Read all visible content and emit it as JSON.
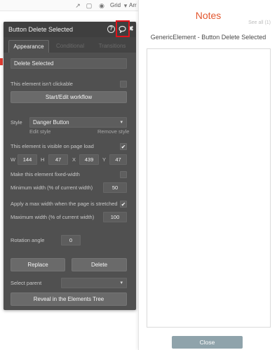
{
  "toolbar": {
    "grid_label": "Grid",
    "arrange_label": "Arr"
  },
  "panel": {
    "title": "Button Delete Selected",
    "tabs": [
      {
        "label": "Appearance",
        "active": true
      },
      {
        "label": "Conditional",
        "active": false
      },
      {
        "label": "Transitions",
        "active": false
      }
    ],
    "text_value": "Delete Selected",
    "not_clickable_label": "This element isn't clickable",
    "not_clickable_checked": false,
    "workflow_button": "Start/Edit workflow",
    "style_label": "Style",
    "style_value": "Danger Button",
    "edit_style": "Edit style",
    "remove_style": "Remove style",
    "visible_label": "This element is visible on page load",
    "visible_checked": true,
    "dims": {
      "w_label": "W",
      "w_value": "144",
      "h_label": "H",
      "h_value": "47",
      "x_label": "X",
      "x_value": "439",
      "y_label": "Y",
      "y_value": "47"
    },
    "fixed_width_label": "Make this element fixed-width",
    "fixed_width_checked": false,
    "min_width_label": "Minimum width (% of current width)",
    "min_width_value": "50",
    "max_width_apply_label": "Apply a max width when the page is stretched",
    "max_width_apply_checked": true,
    "max_width_label": "Maximum width (% of current width)",
    "max_width_value": "100",
    "rotation_label": "Rotation angle",
    "rotation_value": "0",
    "replace_button": "Replace",
    "delete_button": "Delete",
    "select_parent_label": "Select parent",
    "reveal_button": "Reveal in the Elements Tree"
  },
  "notes": {
    "title": "Notes",
    "see_all": "See all (1)",
    "subtitle": "GenericElement - Button Delete Selected",
    "close_button": "Close"
  },
  "colors": {
    "notes_title": "#e3572f",
    "panel_bg": "#505050",
    "highlight": "#e0141c",
    "close_button_bg": "#8fa3ab"
  }
}
